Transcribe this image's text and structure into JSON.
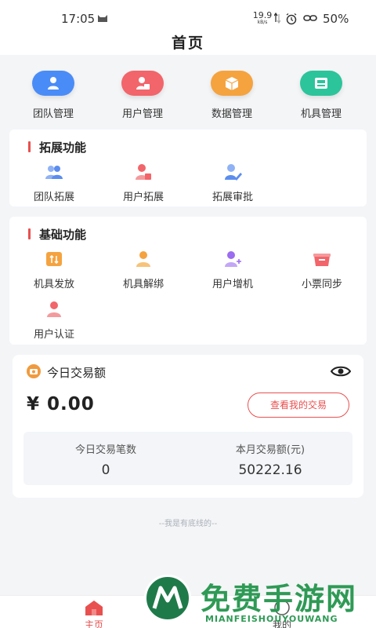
{
  "status_bar": {
    "time": "17:05",
    "net_speed": "19.9",
    "net_speed_unit": "kB/s",
    "battery": "50%",
    "icons": [
      "cat-icon",
      "data-arrows-icon",
      "alarm-icon",
      "link-icon"
    ]
  },
  "header": {
    "title": "首页"
  },
  "quick_nav": [
    {
      "label": "团队管理",
      "icon": "team-icon",
      "color": "#4a8cf7"
    },
    {
      "label": "用户管理",
      "icon": "user-card-icon",
      "color": "#f2656a"
    },
    {
      "label": "数据管理",
      "icon": "box-icon",
      "color": "#f5a33f"
    },
    {
      "label": "机具管理",
      "icon": "pos-icon",
      "color": "#2cc49b"
    }
  ],
  "extension": {
    "title": "拓展功能",
    "items": [
      {
        "label": "团队拓展",
        "icon": "team-icon",
        "color": "#5b8def"
      },
      {
        "label": "用户拓展",
        "icon": "user-card-icon",
        "color": "#f2656a"
      },
      {
        "label": "拓展审批",
        "icon": "user-edit-icon",
        "color": "#5b8def"
      }
    ]
  },
  "basic": {
    "title": "基础功能",
    "items": [
      {
        "label": "机具发放",
        "icon": "device-send-icon",
        "color": "#f5a33f"
      },
      {
        "label": "机具解绑",
        "icon": "user-icon",
        "color": "#f5a33f"
      },
      {
        "label": "用户增机",
        "icon": "user-add-icon",
        "color": "#9b6cf0"
      },
      {
        "label": "小票同步",
        "icon": "receipt-box-icon",
        "color": "#f2656a"
      },
      {
        "label": "用户认证",
        "icon": "user-verify-icon",
        "color": "#f2656a"
      }
    ]
  },
  "transaction": {
    "title": "今日交易额",
    "amount": "¥ 0.00",
    "view_button": "查看我的交易",
    "stats": [
      {
        "label": "今日交易笔数",
        "value": "0"
      },
      {
        "label": "本月交易额(元)",
        "value": "50222.16"
      }
    ]
  },
  "footer_note": "--我是有底线的--",
  "tabbar": {
    "items": [
      {
        "label": "主页",
        "active": true
      },
      {
        "label": "我的",
        "active": false
      }
    ]
  },
  "watermark": {
    "title": "免费手游网",
    "subtitle": "MIANFEISHOUYOUWANG"
  },
  "colors": {
    "accent": "#e8504f",
    "background": "#f4f5f7",
    "card": "#ffffff",
    "watermark": "#2e9a55"
  }
}
